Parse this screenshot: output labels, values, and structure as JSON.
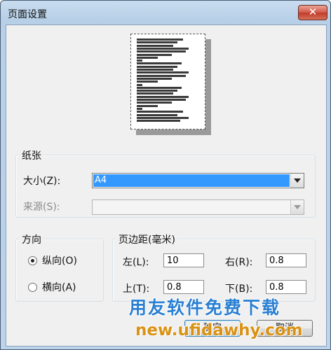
{
  "window": {
    "title": "页面设置",
    "close_glyph": "✕"
  },
  "paper": {
    "legend": "纸张",
    "size_label": "大小(Z):",
    "size_value": "A4",
    "source_label": "来源(S):",
    "source_value": ""
  },
  "orientation": {
    "legend": "方向",
    "portrait_label": "纵向(O)",
    "landscape_label": "横向(A)",
    "selected": "portrait"
  },
  "margins": {
    "legend": "页边距(毫米)",
    "left_label": "左(L):",
    "left_value": "10",
    "right_label": "右(R):",
    "right_value": "0.8",
    "top_label": "上(T):",
    "top_value": "0.8",
    "bottom_label": "下(B):",
    "bottom_value": "0.8"
  },
  "buttons": {
    "ok_label": "确定",
    "cancel_label": "取消"
  },
  "watermark": {
    "line1": "用友软件免费下载",
    "line2": "new.ufidawhy.com"
  },
  "colors": {
    "selection": "#3399ff",
    "watermark_blue": "#2a7fd2",
    "watermark_orange": "#d99214",
    "close_red": "#c23a29"
  }
}
